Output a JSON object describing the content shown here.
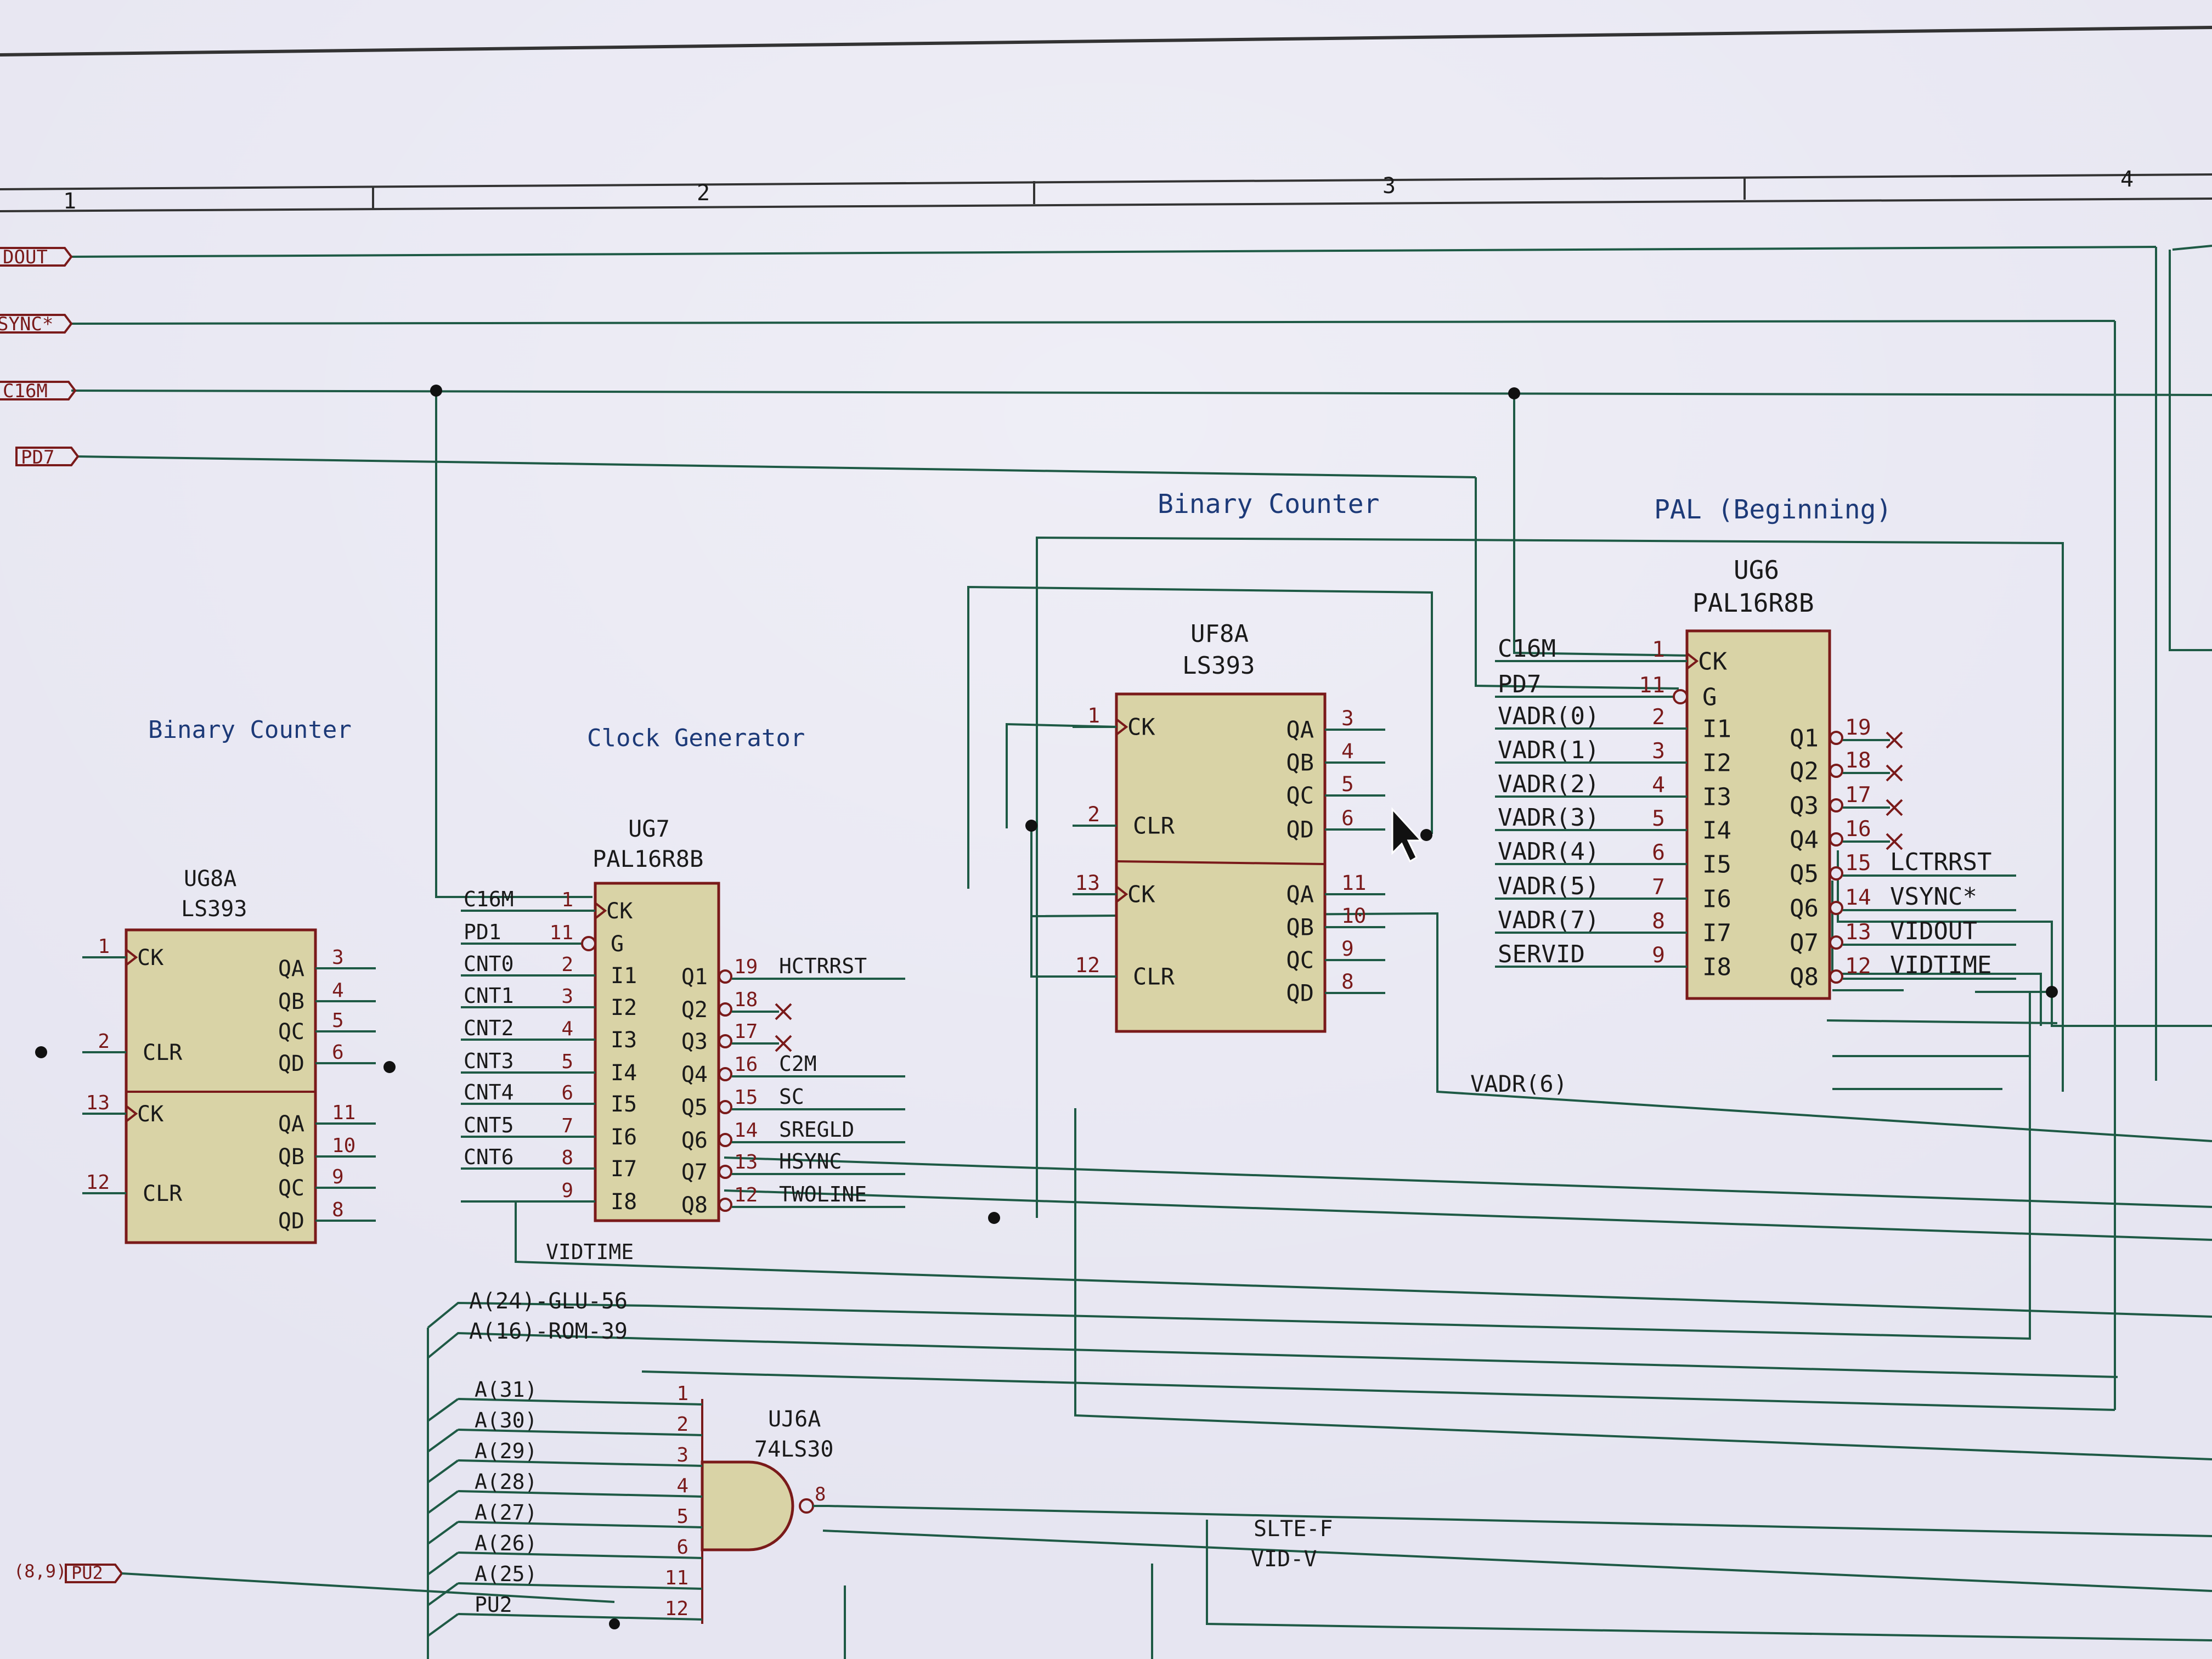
{
  "border": {
    "column_numbers": [
      "1",
      "2",
      "3",
      "4"
    ]
  },
  "ports": [
    {
      "label": "DOUT"
    },
    {
      "label": "SYNC*"
    },
    {
      "label": "C16M"
    },
    {
      "label": "PD7"
    },
    {
      "label": "PU2",
      "prefix": "(8,9)"
    }
  ],
  "titles": {
    "binary_counter_left": "Binary Counter",
    "clock_generator": "Clock Generator",
    "binary_counter_right": "Binary Counter",
    "pal_beginning": "PAL (Beginning)"
  },
  "chips": {
    "ug8a": {
      "ref": "UG8A",
      "part": "LS393",
      "pins_left": [
        {
          "num": "1",
          "name": "CK"
        },
        {
          "num": "2",
          "name": "CLR"
        },
        {
          "num": "13",
          "name": "CK"
        },
        {
          "num": "12",
          "name": "CLR"
        }
      ],
      "pins_right": [
        {
          "num": "3",
          "name": "QA"
        },
        {
          "num": "4",
          "name": "QB"
        },
        {
          "num": "5",
          "name": "QC"
        },
        {
          "num": "6",
          "name": "QD"
        },
        {
          "num": "11",
          "name": "QA"
        },
        {
          "num": "10",
          "name": "QB"
        },
        {
          "num": "9",
          "name": "QC"
        },
        {
          "num": "8",
          "name": "QD"
        }
      ]
    },
    "ug7": {
      "ref": "UG7",
      "part": "PAL16R8B",
      "pins_left": [
        {
          "num": "1",
          "name": "CK",
          "net": "C16M"
        },
        {
          "num": "11",
          "name": "G",
          "net": "PD1"
        },
        {
          "num": "2",
          "name": "I1",
          "net": "CNT0"
        },
        {
          "num": "3",
          "name": "I2",
          "net": "CNT1"
        },
        {
          "num": "4",
          "name": "I3",
          "net": "CNT2"
        },
        {
          "num": "5",
          "name": "I4",
          "net": "CNT3"
        },
        {
          "num": "6",
          "name": "I5",
          "net": "CNT4"
        },
        {
          "num": "7",
          "name": "I6",
          "net": "CNT5"
        },
        {
          "num": "8",
          "name": "I7",
          "net": "CNT6"
        },
        {
          "num": "9",
          "name": "I8",
          "net": ""
        }
      ],
      "pins_right": [
        {
          "num": "19",
          "name": "Q1",
          "net": "HCTRRST"
        },
        {
          "num": "18",
          "name": "Q2",
          "net": ""
        },
        {
          "num": "17",
          "name": "Q3",
          "net": ""
        },
        {
          "num": "16",
          "name": "Q4",
          "net": "C2M"
        },
        {
          "num": "15",
          "name": "Q5",
          "net": "SC"
        },
        {
          "num": "14",
          "name": "Q6",
          "net": "SREGLD"
        },
        {
          "num": "13",
          "name": "Q7",
          "net": "HSYNC"
        },
        {
          "num": "12",
          "name": "Q8",
          "net": "TWOLINE"
        }
      ],
      "bottom_net": "VIDTIME"
    },
    "uf8a": {
      "ref": "UF8A",
      "part": "LS393",
      "pins_left": [
        {
          "num": "1",
          "name": "CK"
        },
        {
          "num": "2",
          "name": "CLR"
        },
        {
          "num": "13",
          "name": "CK"
        },
        {
          "num": "12",
          "name": "CLR"
        }
      ],
      "pins_right": [
        {
          "num": "3",
          "name": "QA"
        },
        {
          "num": "4",
          "name": "QB"
        },
        {
          "num": "5",
          "name": "QC"
        },
        {
          "num": "6",
          "name": "QD"
        },
        {
          "num": "11",
          "name": "QA"
        },
        {
          "num": "10",
          "name": "QB"
        },
        {
          "num": "9",
          "name": "QC"
        },
        {
          "num": "8",
          "name": "QD"
        }
      ],
      "bottom_net": "VADR(6)"
    },
    "ug6": {
      "ref": "UG6",
      "part": "PAL16R8B",
      "pins_left": [
        {
          "num": "1",
          "name": "CK",
          "net": "C16M"
        },
        {
          "num": "11",
          "name": "G",
          "net": "PD7"
        },
        {
          "num": "2",
          "name": "I1",
          "net": "VADR(0)"
        },
        {
          "num": "3",
          "name": "I2",
          "net": "VADR(1)"
        },
        {
          "num": "4",
          "name": "I3",
          "net": "VADR(2)"
        },
        {
          "num": "5",
          "name": "I4",
          "net": "VADR(3)"
        },
        {
          "num": "6",
          "name": "I5",
          "net": "VADR(4)"
        },
        {
          "num": "7",
          "name": "I6",
          "net": "VADR(5)"
        },
        {
          "num": "8",
          "name": "I7",
          "net": "VADR(7)"
        },
        {
          "num": "9",
          "name": "I8",
          "net": "SERVID"
        }
      ],
      "pins_right": [
        {
          "num": "19",
          "name": "Q1",
          "net": ""
        },
        {
          "num": "18",
          "name": "Q2",
          "net": ""
        },
        {
          "num": "17",
          "name": "Q3",
          "net": ""
        },
        {
          "num": "16",
          "name": "Q4",
          "net": ""
        },
        {
          "num": "15",
          "name": "Q5",
          "net": "LCTRRST"
        },
        {
          "num": "14",
          "name": "Q6",
          "net": "VSYNC*"
        },
        {
          "num": "13",
          "name": "Q7",
          "net": "VIDOUT"
        },
        {
          "num": "12",
          "name": "Q8",
          "net": "VIDTIME"
        }
      ]
    },
    "uj6a": {
      "ref": "UJ6A",
      "part": "74LS30",
      "output_pin": "8",
      "inputs": [
        {
          "num": "1",
          "net": "A(31)"
        },
        {
          "num": "2",
          "net": "A(30)"
        },
        {
          "num": "3",
          "net": "A(29)"
        },
        {
          "num": "4",
          "net": "A(28)"
        },
        {
          "num": "5",
          "net": "A(27)"
        },
        {
          "num": "6",
          "net": "A(26)"
        },
        {
          "num": "11",
          "net": "A(25)"
        },
        {
          "num": "12",
          "net": "PU2"
        }
      ]
    }
  },
  "bus_labels": [
    "A(24)-GLU-56",
    "A(16)-ROM-39"
  ],
  "bottom_nets": [
    "SLTE-F",
    "VID-V"
  ],
  "colors": {
    "wire": "#1e5a45",
    "chip_fill": "#d9d3a6",
    "chip_outline": "#7a1a1a",
    "title": "#1d3a78",
    "background": "#e6e5f1"
  }
}
